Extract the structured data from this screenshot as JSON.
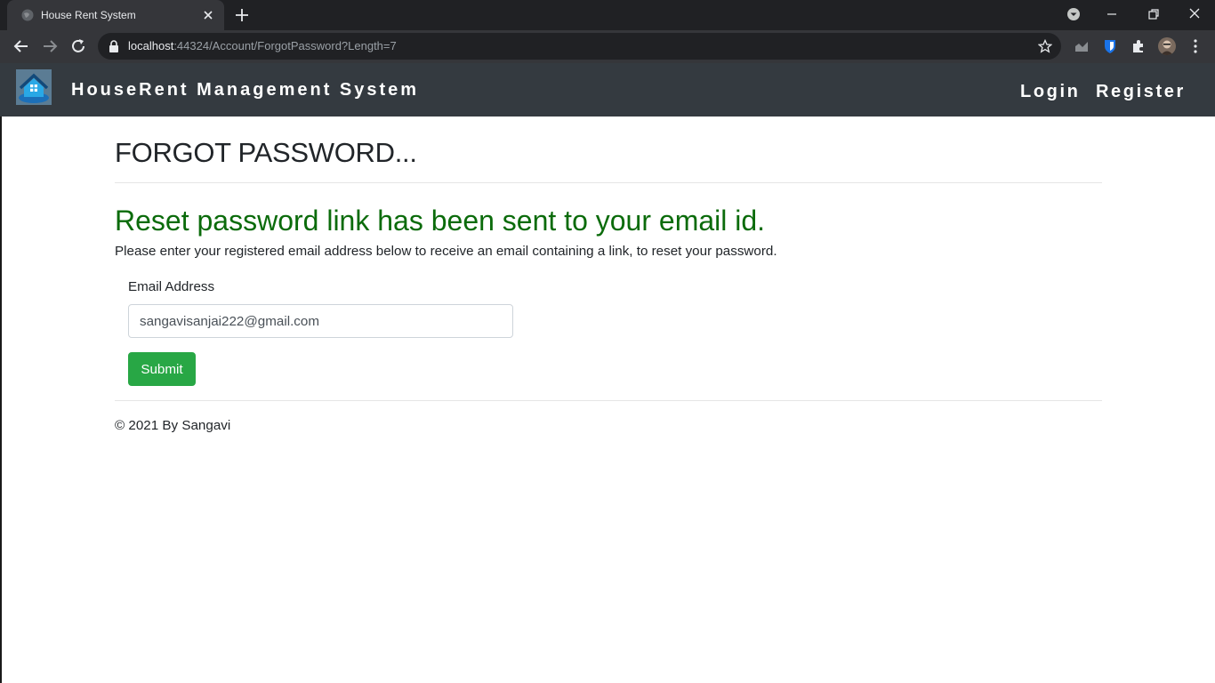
{
  "browser": {
    "tab_title": "House Rent System",
    "url_host": "localhost",
    "url_rest": ":44324/Account/ForgotPassword?Length=7"
  },
  "navbar": {
    "brand": "HouseRent Management System",
    "login": "Login",
    "register": "Register"
  },
  "page": {
    "title": "FORGOT PASSWORD...",
    "success_message": "Reset password link has been sent to your email id.",
    "instructions": "Please enter your registered email address below to receive an email containing a link, to reset your password.",
    "email_label": "Email Address",
    "email_value": "sangavisanjai222@gmail.com",
    "submit_label": "Submit",
    "footer": "© 2021 By Sangavi"
  },
  "colors": {
    "navbar_bg": "#343a40",
    "success_text": "#0b6b0b",
    "submit_bg": "#28a745"
  }
}
